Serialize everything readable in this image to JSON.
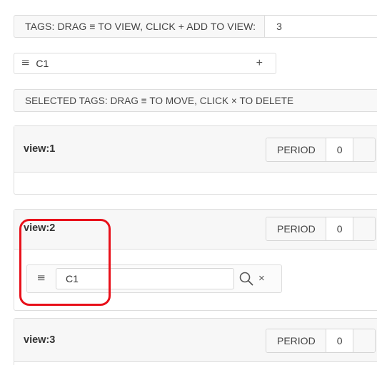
{
  "tags_bar": {
    "label": "TAGS: DRAG ≡ TO VIEW, CLICK + ADD TO VIEW:",
    "count_value": "3"
  },
  "available_tags": [
    {
      "name": "C1",
      "handle": "≡",
      "add": "+"
    }
  ],
  "selected_bar": {
    "label": "SELECTED TAGS: DRAG ≡ TO MOVE, CLICK × TO DELETE"
  },
  "views": [
    {
      "title": "view:1",
      "period_label": "PERIOD",
      "period_value": "0",
      "tags": []
    },
    {
      "title": "view:2",
      "period_label": "PERIOD",
      "period_value": "0",
      "tags": [
        {
          "value": "C1",
          "handle": "≡",
          "remove": "×"
        }
      ]
    },
    {
      "title": "view:3",
      "period_label": "PERIOD",
      "period_value": "0",
      "tags": []
    }
  ],
  "colors": {
    "highlight": "#e8101a",
    "border": "#dddddd",
    "header_bg": "#f7f7f7"
  },
  "icons": {
    "drag_handle": "hamburger-icon",
    "add": "plus-icon",
    "search": "search-icon",
    "remove": "close-icon",
    "dropdown": "chevron-down-icon"
  }
}
